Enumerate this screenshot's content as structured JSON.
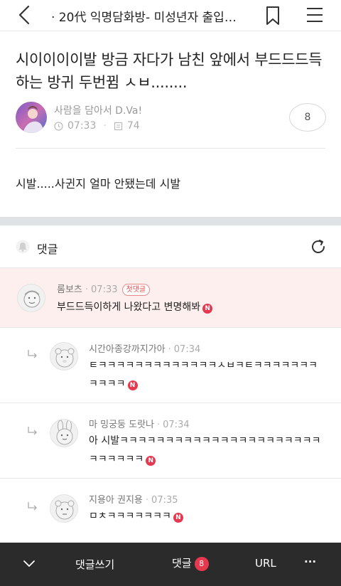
{
  "header": {
    "cafe_title": "· 20代 익명담화방- 미성년자 출입…"
  },
  "post": {
    "title": "시이이이이발 방금 자다가 남친 앞에서 부드드드득하는 방귀 두번뀜 ㅅㅂ........",
    "author": "사람을 담아서 D.Va!",
    "time": "07:33",
    "views": "74",
    "comment_count": "8",
    "body": "시발.....사귄지 얼마 안됐는데 시발"
  },
  "comments_section": {
    "label": "댓글"
  },
  "comments": [
    {
      "author": "롬보츠",
      "time": "07:33",
      "badge": "첫댓글",
      "text": "부드드득이하게 나왔다고 변명해봐"
    },
    {
      "author": "시간아종강까지가아",
      "time": "07:34",
      "text": "ㅌㅋㅋㅋㅋㅋㅋㅋㅋㅋㅋㅋㅋㅋㅅㅂㅋㅌㅋㅋㅋㅋㅋㅋㅋㅋㅋㅋㅋ"
    },
    {
      "author": "마 밍궁둥 도랏나",
      "time": "07:34",
      "text": "아 시발ㅋㅋㅋㅋㅋㅋㅋㅋㅋㅋㅋㅋㅋㅋㅋㅋㅋㅋㅋㅋㅋㅋㅋㅋㅋㅋㅋㅋ"
    },
    {
      "author": "지용아 권지용",
      "time": "07:35",
      "text": "ㅁㅊㅋㅋㅋㅋㅋㅋㅋ"
    }
  ],
  "new_badge": "N",
  "bottom_bar": {
    "write_comment": "댓글쓰기",
    "comments": "댓글",
    "comments_count": "8",
    "url": "URL",
    "more": "···"
  },
  "colors": {
    "accent_red": "#e6394f",
    "first_comment_bg": "#fcefee",
    "bottom_bar_bg": "#2b2b2b"
  },
  "icons": [
    "back-icon",
    "bookmark-icon",
    "hamburger-menu-icon",
    "clock-icon",
    "view-count-icon",
    "bell-icon",
    "refresh-icon",
    "reply-arrow-icon",
    "chevron-down-icon"
  ]
}
